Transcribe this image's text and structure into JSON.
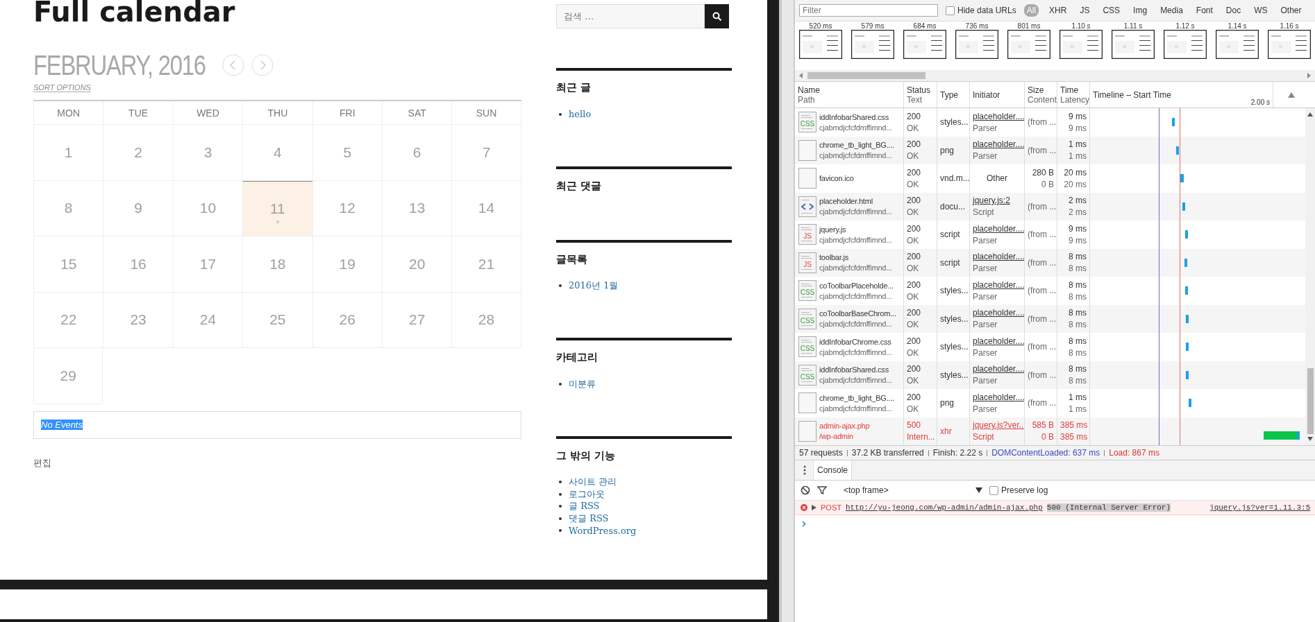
{
  "page": {
    "title": "Full calendar",
    "month_title": "FEBRUARY, 2016",
    "sort_options": "SORT OPTIONS",
    "weekdays": [
      "MON",
      "TUE",
      "WED",
      "THU",
      "FRI",
      "SAT",
      "SUN"
    ],
    "weeks": [
      [
        {
          "day": "1",
          "selected": false
        },
        {
          "day": "2",
          "selected": false
        },
        {
          "day": "3",
          "selected": false
        },
        {
          "day": "4",
          "selected": false
        },
        {
          "day": "5",
          "selected": false
        },
        {
          "day": "6",
          "selected": false
        },
        {
          "day": "7",
          "selected": false
        }
      ],
      [
        {
          "day": "8",
          "selected": false
        },
        {
          "day": "9",
          "selected": false
        },
        {
          "day": "10",
          "selected": false
        },
        {
          "day": "11",
          "selected": true
        },
        {
          "day": "12",
          "selected": false
        },
        {
          "day": "13",
          "selected": false
        },
        {
          "day": "14",
          "selected": false
        }
      ],
      [
        {
          "day": "15",
          "selected": false
        },
        {
          "day": "16",
          "selected": false
        },
        {
          "day": "17",
          "selected": false
        },
        {
          "day": "18",
          "selected": false
        },
        {
          "day": "19",
          "selected": false
        },
        {
          "day": "20",
          "selected": false
        },
        {
          "day": "21",
          "selected": false
        }
      ],
      [
        {
          "day": "22",
          "selected": false
        },
        {
          "day": "23",
          "selected": false
        },
        {
          "day": "24",
          "selected": false
        },
        {
          "day": "25",
          "selected": false
        },
        {
          "day": "26",
          "selected": false
        },
        {
          "day": "27",
          "selected": false
        },
        {
          "day": "28",
          "selected": false
        }
      ],
      [
        {
          "day": "29",
          "selected": false
        }
      ]
    ],
    "events": {
      "text": "No Events",
      "text_selected": true
    },
    "edit_link": "편집",
    "search": {
      "placeholder": "검색 …"
    },
    "widgets": [
      {
        "title": "최근 글",
        "items": [
          "hello"
        ]
      },
      {
        "title": "최근 댓글"
      },
      {
        "title": "글목록",
        "items": [
          "2016년 1월"
        ]
      },
      {
        "title": "카테고리",
        "items": [
          "미분류"
        ]
      },
      {
        "title": "그 밖의 기능",
        "items": [
          "사이트 관리",
          "로그아웃",
          "글 RSS",
          "댓글 RSS",
          "WordPress.org"
        ]
      }
    ]
  },
  "devtools": {
    "filter": {
      "placeholder": "Filter"
    },
    "hide_data_urls": {
      "label": "Hide data URLs",
      "checked": false
    },
    "types": [
      {
        "label": "All",
        "selected": true
      },
      {
        "label": "XHR",
        "selected": false
      },
      {
        "label": "JS",
        "selected": false
      },
      {
        "label": "CSS",
        "selected": false
      },
      {
        "label": "Img",
        "selected": false
      },
      {
        "label": "Media",
        "selected": false
      },
      {
        "label": "Font",
        "selected": false
      },
      {
        "label": "Doc",
        "selected": false
      },
      {
        "label": "WS",
        "selected": false
      },
      {
        "label": "Other",
        "selected": false
      }
    ],
    "filmstrip": [
      "520 ms",
      "579 ms",
      "684 ms",
      "736 ms",
      "801 ms",
      "1.10 s",
      "1.11 s",
      "1.12 s",
      "1.14 s",
      "1.16 s"
    ],
    "columns": [
      {
        "top": "Name",
        "bottom": "Path"
      },
      {
        "top": "Status",
        "bottom": "Text"
      },
      {
        "top": "Type"
      },
      {
        "top": "Initiator"
      },
      {
        "top": "Size",
        "bottom": "Content"
      },
      {
        "top": "Time",
        "bottom": "Latency"
      },
      {
        "top": "Timeline – Start Time"
      }
    ],
    "timeline_tick": "2.00 s",
    "rows": [
      {
        "icon": {
          "kind": "css",
          "label": "CSS"
        },
        "name": "iddInfobarShared.css",
        "path": "cjabmdjcfcfdmffimnd...",
        "status": "200",
        "status_text": "OK",
        "type": "styles...",
        "initiator": "placeholder....",
        "initiator_kind": "Parser",
        "size": "(from ...",
        "time": "9 ms",
        "latency": "9 ms",
        "error": false
      },
      {
        "icon": {
          "kind": "blank"
        },
        "name": "chrome_tb_light_BG....",
        "path": "cjabmdjcfcfdmffimnd...",
        "status": "200",
        "status_text": "OK",
        "type": "png",
        "initiator": "placeholder....",
        "initiator_kind": "Parser",
        "size": "(from ...",
        "time": "1 ms",
        "latency": "1 ms",
        "error": false
      },
      {
        "icon": {
          "kind": "blank"
        },
        "name": "favicon.ico",
        "status": "200",
        "status_text": "OK",
        "type": "vnd.m...",
        "initiator_plain": "Other",
        "size": "280 B",
        "content": "0 B",
        "time": "20 ms",
        "latency": "20 ms",
        "error": false
      },
      {
        "icon": {
          "kind": "html"
        },
        "name": "placeholder.html",
        "path": "cjabmdjcfcfdmffimnd...",
        "status": "200",
        "status_text": "OK",
        "type": "docu...",
        "initiator": "jquery.js:2",
        "initiator_kind": "Script",
        "size": "(from ...",
        "time": "2 ms",
        "latency": "2 ms",
        "error": false
      },
      {
        "icon": {
          "kind": "js",
          "label": "JS"
        },
        "name": "jquery.js",
        "path": "cjabmdjcfcfdmffimnd...",
        "status": "200",
        "status_text": "OK",
        "type": "script",
        "initiator": "placeholder....",
        "initiator_kind": "Parser",
        "size": "(from ...",
        "time": "9 ms",
        "latency": "9 ms",
        "error": false
      },
      {
        "icon": {
          "kind": "js",
          "label": "JS"
        },
        "name": "toolbar.js",
        "path": "cjabmdjcfcfdmffimnd...",
        "status": "200",
        "status_text": "OK",
        "type": "script",
        "initiator": "placeholder....",
        "initiator_kind": "Parser",
        "size": "(from ...",
        "time": "8 ms",
        "latency": "8 ms",
        "error": false
      },
      {
        "icon": {
          "kind": "css",
          "label": "CSS"
        },
        "name": "coToolbarPlaceholde...",
        "path": "cjabmdjcfcfdmffimnd...",
        "status": "200",
        "status_text": "OK",
        "type": "styles...",
        "initiator": "placeholder....",
        "initiator_kind": "Parser",
        "size": "(from ...",
        "time": "8 ms",
        "latency": "8 ms",
        "error": false
      },
      {
        "icon": {
          "kind": "css",
          "label": "CSS"
        },
        "name": "coToolbarBaseChrom...",
        "path": "cjabmdjcfcfdmffimnd...",
        "status": "200",
        "status_text": "OK",
        "type": "styles...",
        "initiator": "placeholder....",
        "initiator_kind": "Parser",
        "size": "(from ...",
        "time": "8 ms",
        "latency": "8 ms",
        "error": false
      },
      {
        "icon": {
          "kind": "css",
          "label": "CSS"
        },
        "name": "iddInfobarChrome.css",
        "path": "cjabmdjcfcfdmffimnd...",
        "status": "200",
        "status_text": "OK",
        "type": "styles...",
        "initiator": "placeholder....",
        "initiator_kind": "Parser",
        "size": "(from ...",
        "time": "8 ms",
        "latency": "8 ms",
        "error": false
      },
      {
        "icon": {
          "kind": "css",
          "label": "CSS"
        },
        "name": "iddInfobarShared.css",
        "path": "cjabmdjcfcfdmffimnd...",
        "status": "200",
        "status_text": "OK",
        "type": "styles...",
        "initiator": "placeholder....",
        "initiator_kind": "Parser",
        "size": "(from ...",
        "time": "8 ms",
        "latency": "8 ms",
        "error": false
      },
      {
        "icon": {
          "kind": "blank"
        },
        "name": "chrome_tb_light_BG....",
        "path": "cjabmdjcfcfdmffimnd...",
        "status": "200",
        "status_text": "OK",
        "type": "png",
        "initiator": "placeholder....",
        "initiator_kind": "Parser",
        "size": "(from ...",
        "time": "1 ms",
        "latency": "1 ms",
        "error": false
      },
      {
        "icon": {
          "kind": "blank"
        },
        "name": "admin-ajax.php",
        "path": "/wp-admin",
        "status": "500",
        "status_text": "Intern...",
        "type": "xhr",
        "initiator": "jquery.js?ver...",
        "initiator_kind": "Script",
        "size": "585 B",
        "content": "0 B",
        "time": "385 ms",
        "latency": "385 ms",
        "error": true
      }
    ],
    "summary": [
      {
        "text": "57 requests",
        "kind": "plain"
      },
      {
        "text": "37.2 KB transferred",
        "kind": "plain"
      },
      {
        "text": "Finish: 2.22 s",
        "kind": "plain"
      },
      {
        "text": "DOMContentLoaded: 637 ms",
        "kind": "dom"
      },
      {
        "text": "Load: 867 ms",
        "kind": "load"
      }
    ],
    "console": {
      "tab": "Console",
      "context": "<top frame>",
      "preserve_log": {
        "label": "Preserve log",
        "checked": false
      },
      "messages": [
        {
          "kind": "error",
          "method": "POST",
          "url": "http://yu-jeong.com/wp-admin/admin-ajax.php",
          "status": "500 (Internal Server Error)",
          "source": "jquery.js?ver=1.11.3:5"
        }
      ]
    }
  }
}
